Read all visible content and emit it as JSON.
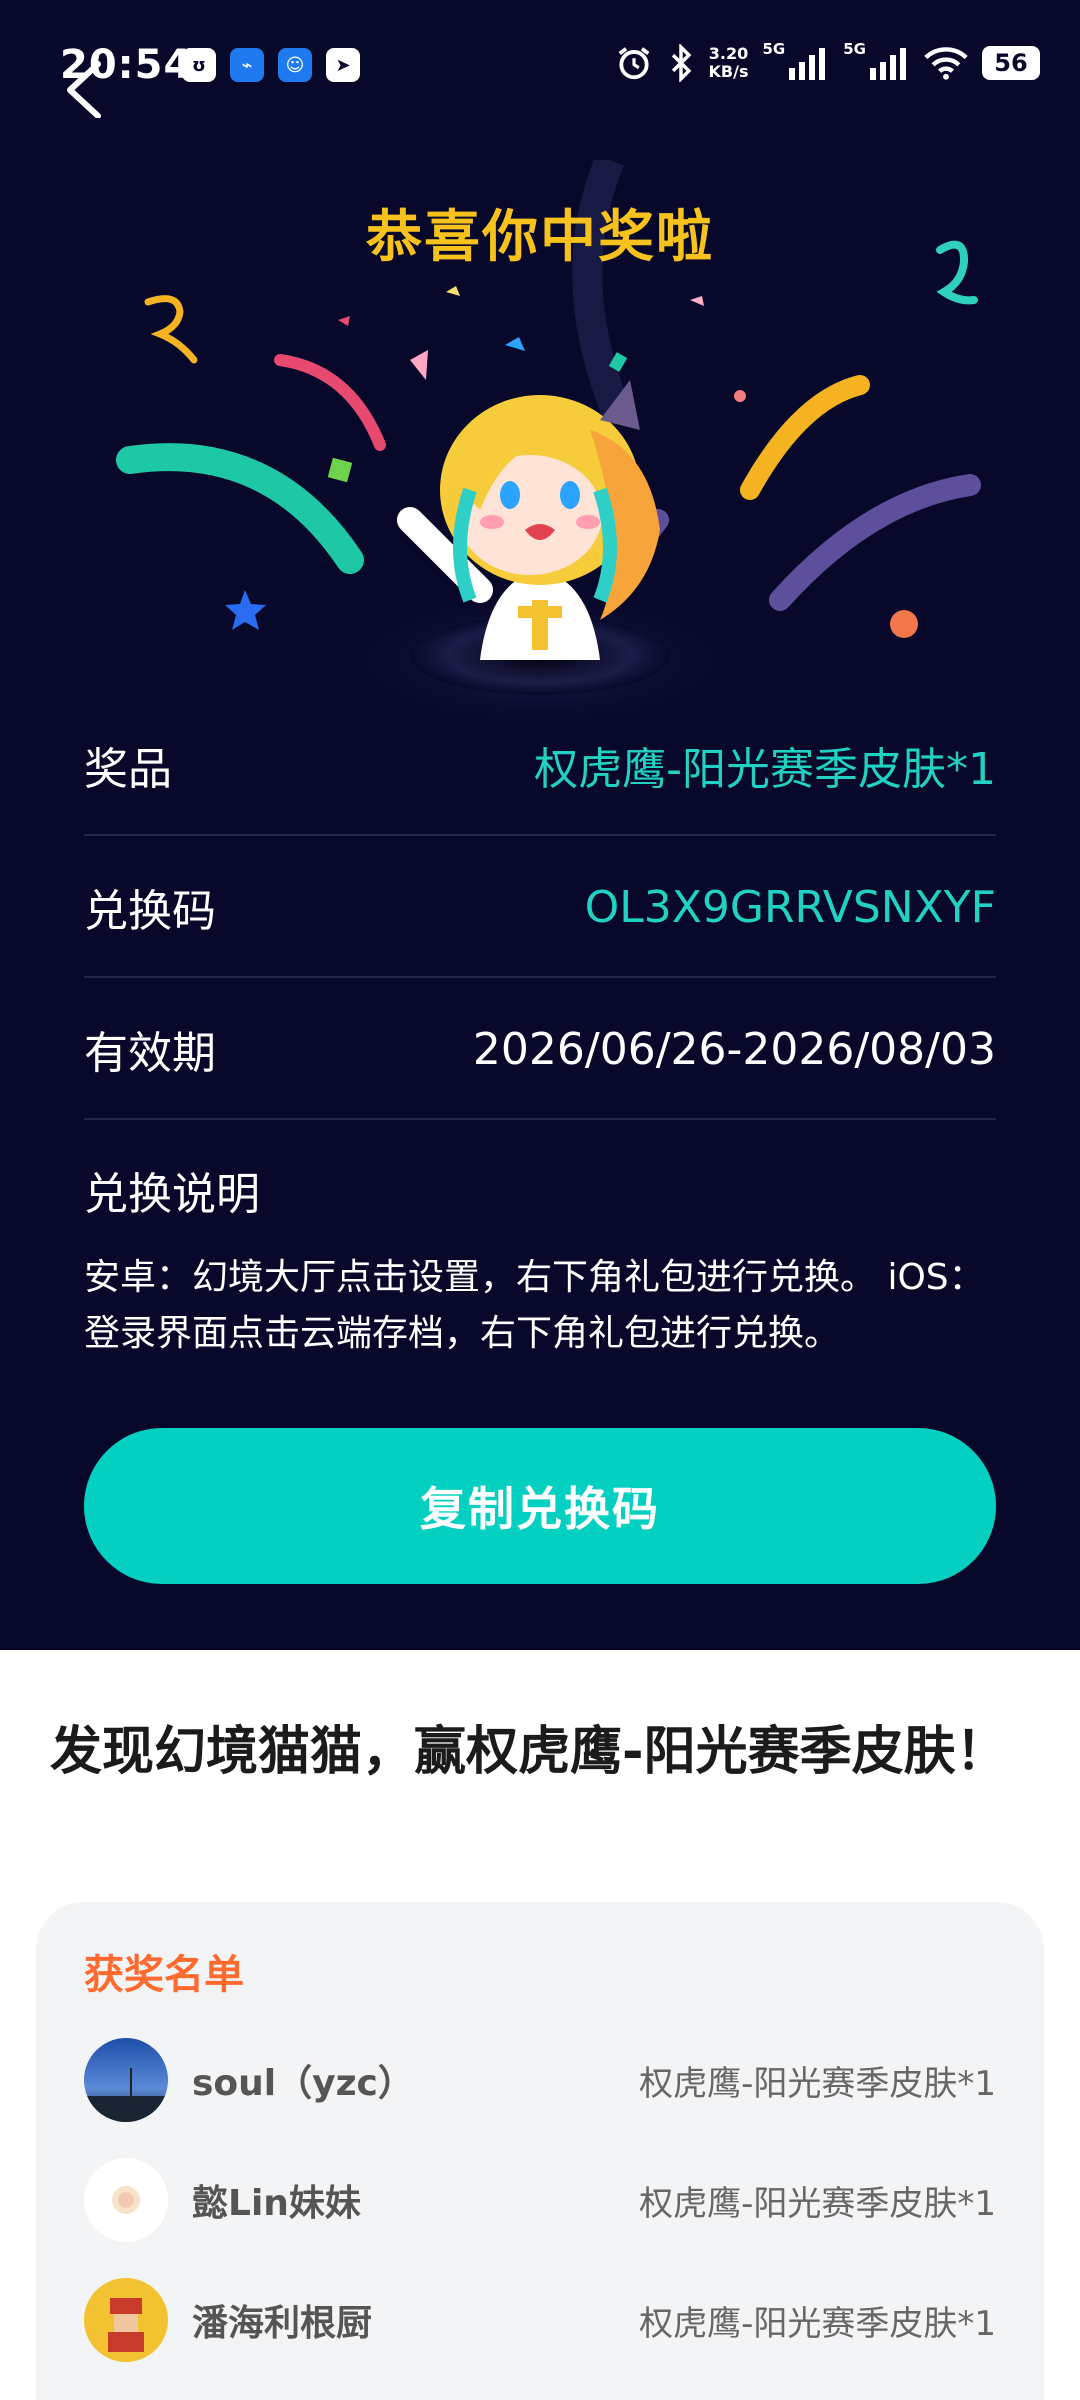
{
  "status_bar": {
    "time": "20:54",
    "net_speed_value": "3.20",
    "net_speed_unit": "KB/s",
    "signal1_label": "5G",
    "signal2_label": "5G",
    "battery": "56"
  },
  "header": {
    "title": "恭喜你中奖啦"
  },
  "prize_info": {
    "prize_label": "奖品",
    "prize_value": "权虎鹰-阳光赛季皮肤*1",
    "code_label": "兑换码",
    "code_value": "OL3X9GRRVSNXYF",
    "validity_label": "有效期",
    "validity_value": "2026/06/26-2026/08/03",
    "instructions_title": "兑换说明",
    "instructions_text": "安卓：幻境大厅点击设置，右下角礼包进行兑换。 iOS：登录界面点击云端存档，右下角礼包进行兑换。"
  },
  "copy_button": {
    "label": "复制兑换码"
  },
  "promo": {
    "title": "发现幻境猫猫，赢权虎鹰-阳光赛季皮肤！"
  },
  "winners": {
    "title": "获奖名单",
    "items": [
      {
        "name": "soul（yzc）",
        "prize": "权虎鹰-阳光赛季皮肤*1"
      },
      {
        "name": "懿Lin妹妹",
        "prize": "权虎鹰-阳光赛季皮肤*1"
      },
      {
        "name": "潘海利根厨",
        "prize": "权虎鹰-阳光赛季皮肤*1"
      }
    ]
  },
  "colors": {
    "background": "#07082a",
    "accent_teal": "#04d0c1",
    "headline_gold": "#f7c21c",
    "winners_title": "#ff6a2f"
  }
}
